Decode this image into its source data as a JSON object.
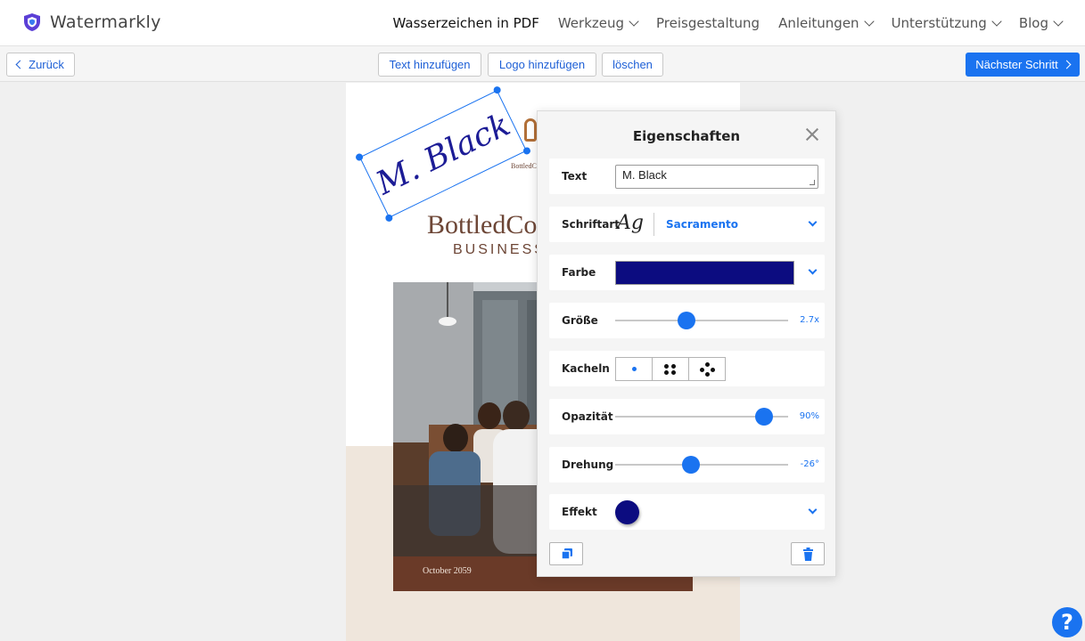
{
  "brand": {
    "name": "Watermarkly",
    "accent": "#5b3fd6"
  },
  "nav": {
    "items": [
      {
        "label": "Wasserzeichen in PDF",
        "dropdown": false,
        "active": true
      },
      {
        "label": "Werkzeug",
        "dropdown": true
      },
      {
        "label": "Preisgestaltung",
        "dropdown": false
      },
      {
        "label": "Anleitungen",
        "dropdown": true
      },
      {
        "label": "Unterstützung",
        "dropdown": true
      },
      {
        "label": "Blog",
        "dropdown": true
      }
    ]
  },
  "toolbar": {
    "back_label": "Zurück",
    "add_text_label": "Text hinzufügen",
    "add_logo_label": "Logo hinzufügen",
    "delete_label": "löschen",
    "next_label": "Nächster Schritt"
  },
  "document": {
    "title": "BottledCo",
    "subtitle": "BUSINESS",
    "small_brand": "BottledC",
    "caption": "October 2059"
  },
  "watermark": {
    "text": "M. Black",
    "color": "#1c1c96"
  },
  "panel": {
    "title": "Eigenschaften",
    "text_label": "Text",
    "text_value": "M. Black",
    "font_label": "Schriftart",
    "font_preview": "Ag",
    "font_name": "Sacramento",
    "color_label": "Farbe",
    "color_value": "#0c0c80",
    "size_label": "Größe",
    "size_value": "2.7x",
    "size_fraction": 0.41,
    "tiles_label": "Kacheln",
    "tile_options": [
      "single-tile-icon",
      "four-tiles-icon",
      "diagonal-tiles-icon"
    ],
    "opacity_label": "Opazität",
    "opacity_value": "90%",
    "opacity_fraction": 0.86,
    "rotation_label": "Drehung",
    "rotation_value": "-26°",
    "rotation_fraction": 0.44,
    "effect_label": "Effekt",
    "effect_color": "#0c0c80"
  },
  "help_label": "?"
}
